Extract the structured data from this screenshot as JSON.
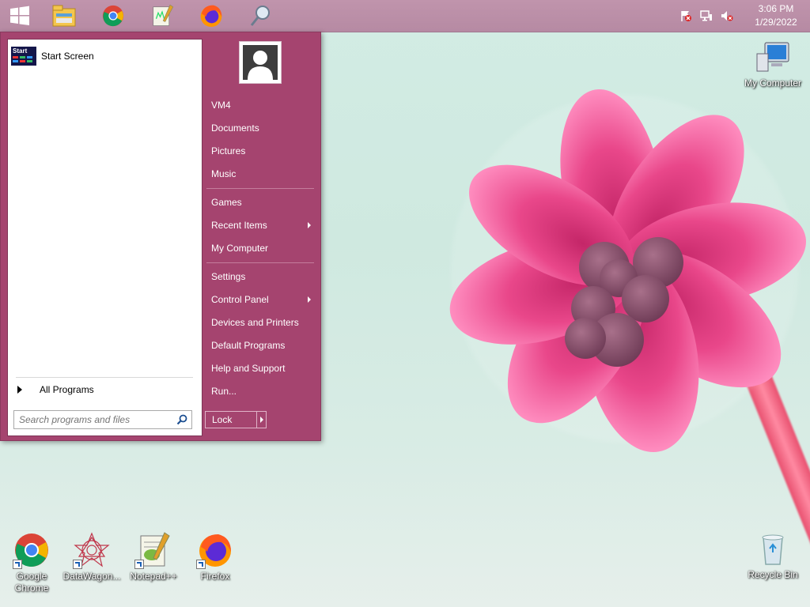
{
  "taskbar": {
    "pinned": [
      {
        "name": "start-button",
        "icon": "windows-logo-icon"
      },
      {
        "name": "file-explorer",
        "icon": "file-explorer-icon"
      },
      {
        "name": "chrome",
        "icon": "chrome-icon"
      },
      {
        "name": "notepadpp",
        "icon": "notepadpp-icon"
      },
      {
        "name": "firefox",
        "icon": "firefox-icon"
      },
      {
        "name": "search",
        "icon": "magnifier-icon"
      }
    ],
    "clock": {
      "time": "3:06 PM",
      "date": "1/29/2022"
    }
  },
  "start_menu": {
    "pinned_items": [
      {
        "label": "Start Screen",
        "icon": "start-screen-icon"
      }
    ],
    "all_programs_label": "All Programs",
    "search_placeholder": "Search programs and files",
    "right_items_group1": [
      {
        "label": "VM4"
      },
      {
        "label": "Documents"
      },
      {
        "label": "Pictures"
      },
      {
        "label": "Music"
      }
    ],
    "right_items_group2": [
      {
        "label": "Games"
      },
      {
        "label": "Recent Items",
        "submenu": true
      },
      {
        "label": "My Computer"
      }
    ],
    "right_items_group3": [
      {
        "label": "Settings"
      },
      {
        "label": "Control Panel",
        "submenu": true
      },
      {
        "label": "Devices and Printers"
      },
      {
        "label": "Default Programs"
      },
      {
        "label": "Help and Support"
      },
      {
        "label": "Run..."
      }
    ],
    "lock_label": "Lock"
  },
  "desktop_icons": {
    "my_computer": "My Computer",
    "recycle_bin": "Recycle Bin",
    "chrome": "Google Chrome",
    "datawagon": "DataWagon...",
    "notepadpp": "Notepad++",
    "firefox": "Firefox"
  },
  "colors": {
    "taskbar": "#b98ca6",
    "start_menu": "#a5446f",
    "flower": "#e9478a"
  }
}
